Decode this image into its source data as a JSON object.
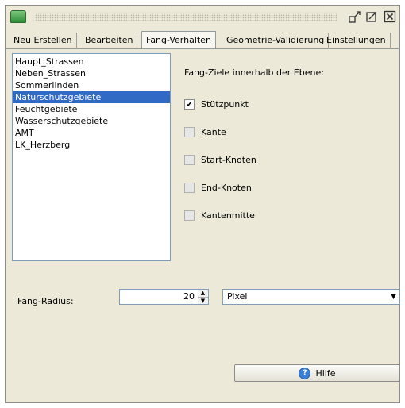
{
  "window": {
    "icons": {
      "app": "app-icon",
      "undock": "undock-icon",
      "maximize": "maximize-icon",
      "close": "close-icon"
    }
  },
  "tabs": [
    {
      "label": "Neu Erstellen",
      "active": false
    },
    {
      "label": "Bearbeiten",
      "active": false
    },
    {
      "label": "Fang-Verhalten",
      "active": true
    },
    {
      "label": "Geometrie-Validierung",
      "active": false
    },
    {
      "label": "Einstellungen",
      "active": false
    }
  ],
  "layers": {
    "items": [
      "Haupt_Strassen",
      "Neben_Strassen",
      "Sommerlinden",
      "Naturschutzgebiete",
      "Feuchtgebiete",
      "Wasserschutzgebiete",
      "AMT",
      "LK_Herzberg"
    ],
    "selected": "Naturschutzgebiete"
  },
  "snap": {
    "heading": "Fang-Ziele innerhalb der Ebene:",
    "targets": [
      {
        "label": "Stützpunkt",
        "checked": true
      },
      {
        "label": "Kante",
        "checked": false
      },
      {
        "label": "Start-Knoten",
        "checked": false
      },
      {
        "label": "End-Knoten",
        "checked": false
      },
      {
        "label": "Kantenmitte",
        "checked": false
      }
    ]
  },
  "radius": {
    "label": "Fang-Radius:",
    "value": "20",
    "unit": "Pixel"
  },
  "help": {
    "label": "Hilfe"
  },
  "colors": {
    "selection": "#316ac5",
    "panel": "#ece9d8",
    "border": "#7f9db9"
  }
}
